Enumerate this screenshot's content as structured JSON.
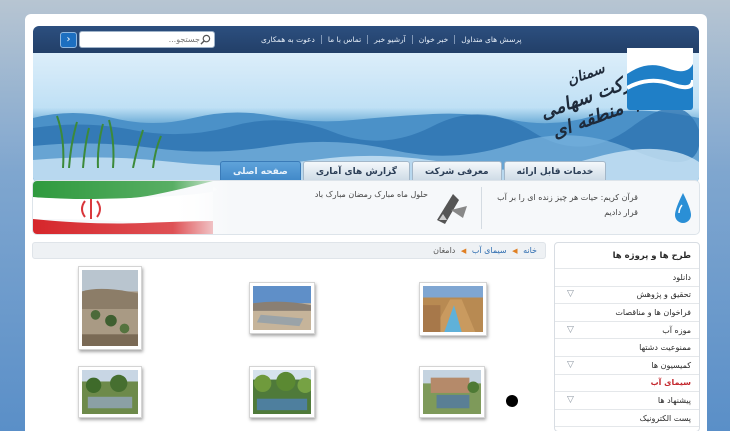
{
  "header": {
    "search_placeholder": "جستجو...",
    "search_go": "›",
    "top_nav": [
      "پرسش های متداول",
      "خبر خوان",
      "آرشیو خبر",
      "تماس با ما",
      "دعوت به همکاری"
    ],
    "logo_line1": "شرکت سهامی آب منطقه ای",
    "logo_line2": "سمنان",
    "tabs": [
      "خدمات قابل ارائه",
      "معرفی شرکت",
      "گزارش های آماری",
      "صفحه اصلی"
    ],
    "active_tab": "صفحه اصلی"
  },
  "quote_bar": {
    "quote": "قرآن کریم: حیات هر چیز زنده ای را بر آب قرار دادیم",
    "news": "حلول ماه مبارک رمضان مبارک باد"
  },
  "breadcrumb": {
    "items": [
      "خانه",
      "سیمای آب",
      "دامغان"
    ]
  },
  "sidebar": {
    "items": [
      {
        "label": "طرح ها و پروژه ها",
        "has_submenu": false
      },
      {
        "label": "دانلود",
        "has_submenu": false
      },
      {
        "label": "تحقیق و پژوهش",
        "has_submenu": true
      },
      {
        "label": "فراخوان ها و مناقصات",
        "has_submenu": false
      },
      {
        "label": "موزه آب",
        "has_submenu": true
      },
      {
        "label": "ممنوعیت دشتها",
        "has_submenu": false
      },
      {
        "label": "کمیسیون ها",
        "has_submenu": true
      },
      {
        "label": "سیمای آب",
        "has_submenu": false,
        "active": true
      },
      {
        "label": "پیشنهاد ها",
        "has_submenu": true
      },
      {
        "label": "پست الکترونیک",
        "has_submenu": false
      }
    ]
  },
  "colors": {
    "header_bar": "#223f68",
    "active_tab": "#3d85c6",
    "active_menu": "#c4292f",
    "breadcrumb_arrow": "#e07f22",
    "link": "#2f6db0"
  },
  "gallery": {
    "count": 6
  }
}
